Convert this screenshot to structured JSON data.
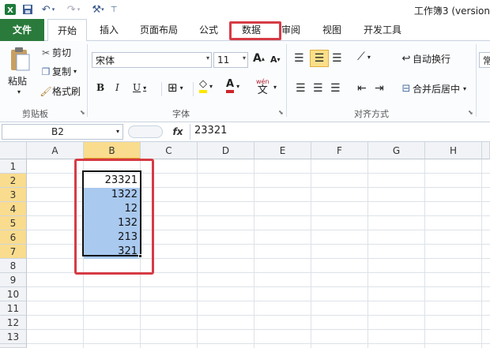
{
  "window": {
    "title": "工作簿3 (version"
  },
  "tabs": [
    {
      "label": "文件"
    },
    {
      "label": "开始"
    },
    {
      "label": "插入"
    },
    {
      "label": "页面布局"
    },
    {
      "label": "公式"
    },
    {
      "label": "数据"
    },
    {
      "label": "审阅"
    },
    {
      "label": "视图"
    },
    {
      "label": "开发工具"
    }
  ],
  "ribbon": {
    "clipboard": {
      "paste": "粘贴",
      "cut": "剪切",
      "copy": "复制",
      "format_painter": "格式刷",
      "group": "剪贴板"
    },
    "font": {
      "name": "宋体",
      "size": "11",
      "group": "字体",
      "wen": "wén",
      "wen2": "文"
    },
    "alignment": {
      "wrap": "自动换行",
      "merge": "合并后居中",
      "group": "对齐方式"
    },
    "number_partial": "常"
  },
  "formula_bar": {
    "name_box": "B2",
    "fx": "fx",
    "value": "23321"
  },
  "columns": [
    "A",
    "B",
    "C",
    "D",
    "E",
    "F",
    "G",
    "H"
  ],
  "rows": [
    "1",
    "2",
    "3",
    "4",
    "5",
    "6",
    "7",
    "8",
    "9",
    "10",
    "11",
    "12",
    "13",
    "14"
  ],
  "cells_b": [
    "23321",
    "1322",
    "12",
    "132",
    "213",
    "321"
  ],
  "colors": {
    "file_tab": "#2a7a3c",
    "highlight": "#d63b45",
    "selection": "#a9c9ef"
  }
}
